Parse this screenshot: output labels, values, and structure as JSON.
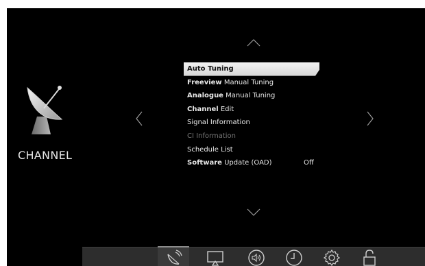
{
  "sidebar": {
    "label": "CHANNEL",
    "icon": "satellite-dish-icon"
  },
  "nav": {
    "up": "chevron-up-icon",
    "down": "chevron-down-icon",
    "left": "chevron-left-icon",
    "right": "chevron-right-icon"
  },
  "menu": {
    "items": [
      {
        "bold": "Auto Tuning",
        "rest": "",
        "value": "",
        "state": "selected"
      },
      {
        "bold": "Freeview",
        "rest": " Manual Tuning",
        "value": "",
        "state": "normal"
      },
      {
        "bold": "Analogue",
        "rest": " Manual Tuning",
        "value": "",
        "state": "normal"
      },
      {
        "bold": "Channel",
        "rest": " Edit",
        "value": "",
        "state": "normal"
      },
      {
        "bold": "",
        "rest": "Signal Information",
        "value": "",
        "state": "normal"
      },
      {
        "bold": "",
        "rest": "CI Information",
        "value": "",
        "state": "disabled"
      },
      {
        "bold": "",
        "rest": "Schedule List",
        "value": "",
        "state": "normal"
      },
      {
        "bold": "Software",
        "rest": " Update (OAD)",
        "value": "Off",
        "state": "normal"
      }
    ]
  },
  "bottom_tabs": [
    {
      "icon": "satellite-dish-icon",
      "active": true
    },
    {
      "icon": "picture-screen-icon",
      "active": false
    },
    {
      "icon": "speaker-sound-icon",
      "active": false
    },
    {
      "icon": "clock-timer-icon",
      "active": false
    },
    {
      "icon": "gear-icon",
      "active": false
    },
    {
      "icon": "lock-icon",
      "active": false
    }
  ]
}
